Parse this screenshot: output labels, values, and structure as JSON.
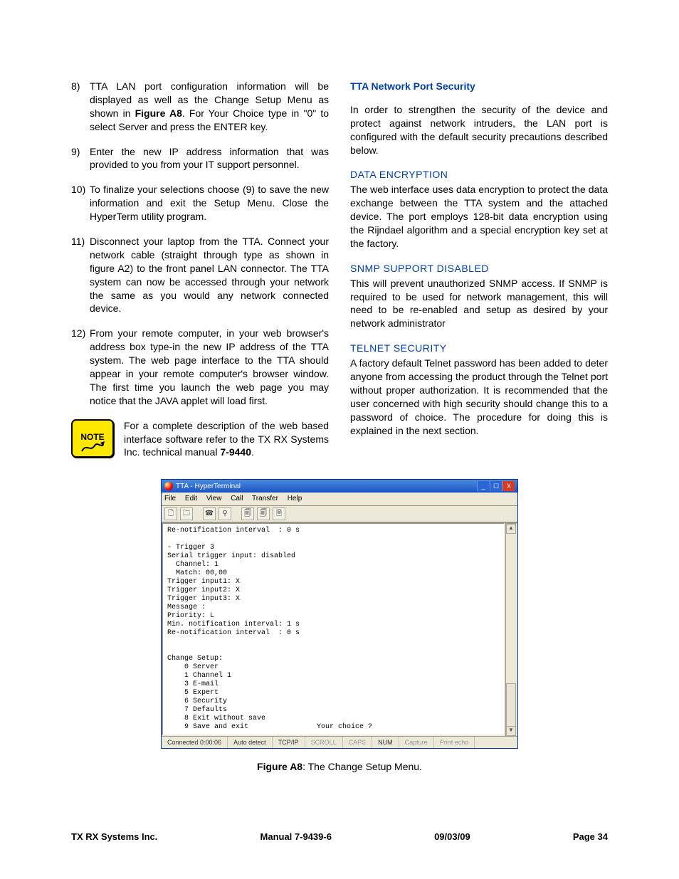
{
  "leftColumn": {
    "items": {
      "n8": {
        "num": "8)",
        "text_a": "TTA LAN port configuration information will be displayed as well as the Change Setup Menu as shown in ",
        "fig_ref": "Figure A8",
        "text_b": ". For Your Choice type in \"0\" to select Server and press the ENTER key."
      },
      "n9": {
        "num": "9)",
        "text": "Enter the new IP address information that was provided to you from your IT support personnel."
      },
      "n10": {
        "num": "10)",
        "text": "To finalize your selections choose (9) to save the new information and exit the Setup Menu. Close the HyperTerm utility program."
      },
      "n11": {
        "num": "11)",
        "text": "Disconnect your laptop from the TTA. Connect your network cable (straight through type as shown in figure A2) to the front panel LAN connector. The TTA system can now be accessed through your network the same as you would any network connected device."
      },
      "n12": {
        "num": "12)",
        "text": "From your remote computer, in your web browser's address box type-in the new IP address of the TTA system. The web page interface to the TTA should appear in your remote computer's browser window. The first time you launch the web page you may notice that the JAVA applet will load first."
      }
    },
    "note": {
      "label": "NOTE",
      "text_a": "For a complete description of the web based interface software refer to the TX RX Systems Inc. technical manual ",
      "manual_ref": "7-9440",
      "text_b": "."
    }
  },
  "rightColumn": {
    "title": "TTA Network Port Security",
    "intro": "In order to strengthen the security of the device and protect against network intruders, the LAN port is configured with the default security precautions described below.",
    "sections": {
      "enc": {
        "heading": "DATA ENCRYPTION",
        "text": "The web interface uses data encryption to protect the data exchange between the TTA system and the attached device. The port employs 128-bit data encryption using the Rijndael algorithm and a special encryption key set at the factory."
      },
      "snmp": {
        "heading": "SNMP SUPPORT DISABLED",
        "text": "This will prevent unauthorized SNMP access. If SNMP is required to be used for network management, this will need to be re-enabled and setup as desired by your network administrator"
      },
      "telnet": {
        "heading": "TELNET SECURITY",
        "text": "A factory default Telnet password has been added to deter anyone from accessing the product through the Telnet port without proper authorization. It is recommended that the user concerned with high security should change this to a password of choice. The procedure for doing this is explained in the next section."
      }
    }
  },
  "hyperterm": {
    "title": "TTA - HyperTerminal",
    "menus": {
      "file": "File",
      "edit": "Edit",
      "view": "View",
      "call": "Call",
      "transfer": "Transfer",
      "help": "Help"
    },
    "winbtns": {
      "min": "_",
      "max": "☐",
      "close": "X"
    },
    "toolbar": {
      "new": "🗋",
      "open": "🗀",
      "connect": "☎",
      "disconnect": "⚲",
      "send": "🗐",
      "recv": "🗐",
      "props": "🗎"
    },
    "scroll": {
      "up": "▲",
      "down": "▼"
    },
    "content": "Re-notification interval  : 0 s\n\n- Trigger 3\nSerial trigger input: disabled\n  Channel: 1\n  Match: 00,00\nTrigger input1: X\nTrigger input2: X\nTrigger input3: X\nMessage :\nPriority: L\nMin. notification interval: 1 s\nRe-notification interval  : 0 s\n\n\nChange Setup:\n    0 Server\n    1 Channel 1\n    3 E-mail\n    5 Expert\n    6 Security\n    7 Defaults\n    8 Exit without save\n    9 Save and exit                Your choice ?",
    "status": {
      "connected": "Connected 0:00:06",
      "autodetect": "Auto detect",
      "proto": "TCP/IP",
      "scroll": "SCROLL",
      "caps": "CAPS",
      "num": "NUM",
      "capture": "Capture",
      "print": "Print echo"
    }
  },
  "figure": {
    "bold": "Figure A8",
    "caption": ": The Change Setup Menu."
  },
  "footer": {
    "left": "TX RX Systems Inc.",
    "center": "Manual 7-9439-6",
    "date": "09/03/09",
    "page": "Page 34"
  }
}
